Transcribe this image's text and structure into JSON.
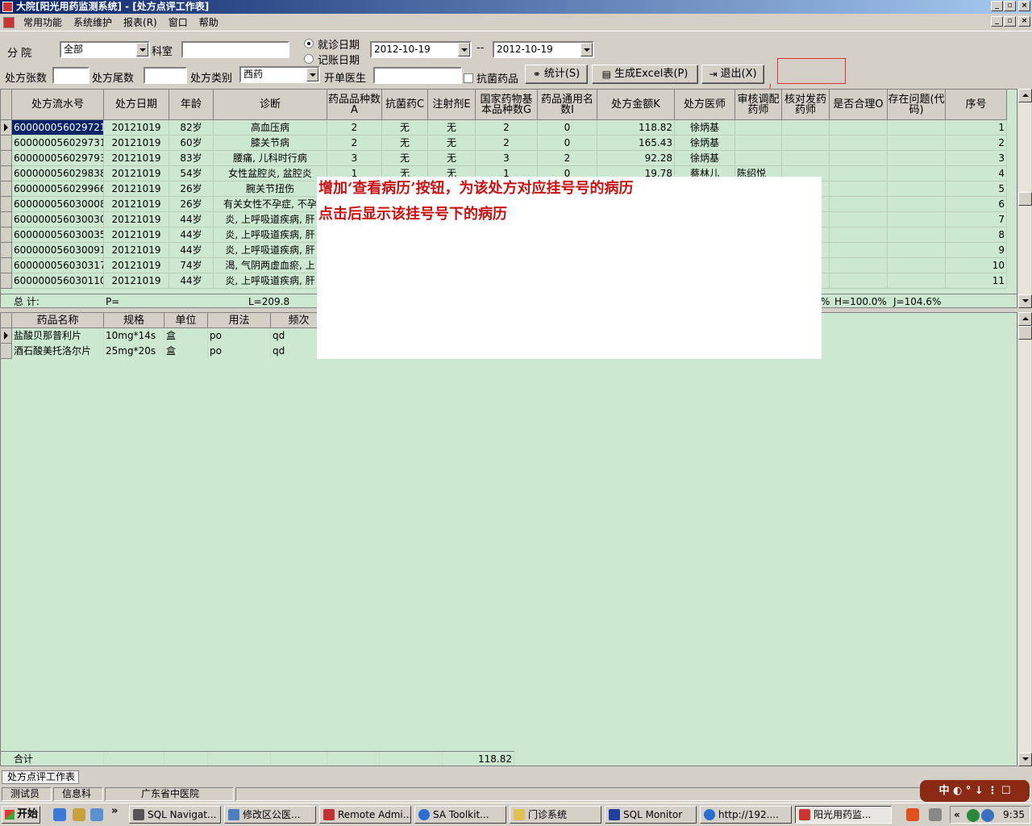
{
  "window": {
    "title": "大院[阳光用药监测系统] - [处方点评工作表]",
    "controls": [
      "_",
      "▫",
      "×"
    ]
  },
  "menu": {
    "items": [
      "常用功能",
      "系统维护",
      "报表(R)",
      "窗口",
      "帮助"
    ],
    "mdi_controls": [
      "_",
      "▫",
      "×"
    ]
  },
  "filters": {
    "branch_label": "分    院",
    "branch_value": "全部",
    "dept_label": "科室",
    "dept_value": "",
    "date_options": [
      "就诊日期",
      "记账日期"
    ],
    "date_from": "2012-10-19",
    "date_sep": "--",
    "date_to": "2012-10-19",
    "count_label": "处方张数",
    "count_value": "",
    "tail_label": "处方尾数",
    "tail_value": "",
    "type_label": "处方类别",
    "type_value": "西药",
    "doctor_label": "开单医生",
    "doctor_value": "",
    "antibiotic_label": "抗菌药品"
  },
  "toolbar": {
    "stats_label": "统计(S)",
    "excel_label": "生成Excel表(P)",
    "exit_label": "退出(X)"
  },
  "grid1": {
    "headers": [
      "处方流水号",
      "处方日期",
      "年龄",
      "诊断",
      "药品品种数A",
      "抗菌药C",
      "注射剂E",
      "国家药物基本品种数G",
      "药品通用名数I",
      "处方金额K",
      "处方医师",
      "审核调配药师",
      "核对发药药师",
      "是否合理O",
      "存在问题(代码)",
      "序号"
    ],
    "rows": [
      [
        "600000056029721",
        "20121019",
        "82岁",
        "高血压病",
        "2",
        "无",
        "无",
        "2",
        "0",
        "118.82",
        "徐炳基",
        "",
        "",
        "",
        "",
        "1"
      ],
      [
        "600000056029731",
        "20121019",
        "60岁",
        "膝关节病",
        "2",
        "无",
        "无",
        "2",
        "0",
        "165.43",
        "徐炳基",
        "",
        "",
        "",
        "",
        "2"
      ],
      [
        "600000056029793",
        "20121019",
        "83岁",
        "腰痛, 儿科时行病",
        "3",
        "无",
        "无",
        "3",
        "2",
        "92.28",
        "徐炳基",
        "",
        "",
        "",
        "",
        "3"
      ],
      [
        "600000056029838",
        "20121019",
        "54岁",
        "女性盆腔炎, 盆腔炎",
        "1",
        "无",
        "无",
        "1",
        "0",
        "19.78",
        "蔡林儿",
        "陈绍悦",
        "",
        "",
        "",
        "4"
      ],
      [
        "600000056029966",
        "20121019",
        "26岁",
        "腕关节扭伤",
        "",
        "",
        "",
        "",
        "",
        "",
        "",
        "",
        "",
        "",
        "",
        "5"
      ],
      [
        "600000056030008",
        "20121019",
        "26岁",
        "有关女性不孕症, 不孕",
        "",
        "",
        "",
        "",
        "",
        "",
        "",
        "",
        "",
        "",
        "",
        "6"
      ],
      [
        "600000056030030",
        "20121019",
        "44岁",
        "炎, 上呼吸道疾病, 肝",
        "",
        "",
        "",
        "",
        "",
        "",
        "",
        "",
        "",
        "",
        "",
        "7"
      ],
      [
        "600000056030035",
        "20121019",
        "44岁",
        "炎, 上呼吸道疾病, 肝",
        "",
        "",
        "",
        "",
        "",
        "",
        "",
        "",
        "",
        "",
        "",
        "8"
      ],
      [
        "600000056030091",
        "20121019",
        "44岁",
        "炎, 上呼吸道疾病, 肝",
        "",
        "",
        "",
        "",
        "",
        "",
        "",
        "",
        "",
        "",
        "",
        "9"
      ],
      [
        "600000056030317",
        "20121019",
        "74岁",
        "渴, 气阴两虚血瘀, 上",
        "",
        "",
        "",
        "",
        "",
        "",
        "",
        "",
        "",
        "",
        "",
        "10"
      ],
      [
        "600000056030110",
        "20121019",
        "44岁",
        "炎, 上呼吸道疾病, 肝",
        "",
        "",
        "",
        "",
        "",
        "",
        "",
        "",
        "",
        "",
        "",
        "11"
      ]
    ],
    "totals": {
      "label": "总  计:",
      "p": "P=",
      "l": "L=209.8",
      "n": "%",
      "h": "H=100.0%",
      "j": "J=104.6%"
    }
  },
  "grid2": {
    "headers": [
      "药品名称",
      "规格",
      "单位",
      "用法",
      "频次"
    ],
    "rows": [
      [
        "盐酸贝那普利片",
        "10mg*14s",
        "盒",
        "po",
        "qd"
      ],
      [
        "酒石酸美托洛尔片",
        "25mg*20s",
        "盒",
        "po",
        "qd"
      ]
    ],
    "sum_label": "合计",
    "sum_value": "118.82"
  },
  "annotation": {
    "line1": "增加‘查看病历’按钮，为该处方对应挂号号的病历",
    "line2": "点击后显示该挂号号下的病历"
  },
  "mdi_tab": "处方点评工作表",
  "statusbar": {
    "user": "测试员",
    "dept": "信息科",
    "hospital": "广东省中医院"
  },
  "ime": {
    "text": "中 ◐ ° ↓ ⋮ ☐"
  },
  "taskbar": {
    "start_label": "开始",
    "tasks": [
      "SQL Navigat...",
      "修改区公医...",
      "Remote Admi...",
      "SA Toolkit...",
      "门诊系统",
      "SQL Monitor",
      "http://192....",
      "阳光用药监..."
    ],
    "clock": "9:35",
    "colors": {
      "title_start": "#0a246a",
      "title_end": "#a6caf0",
      "grid_bg": "#cce8d0",
      "annotation": "#cc1111"
    }
  }
}
